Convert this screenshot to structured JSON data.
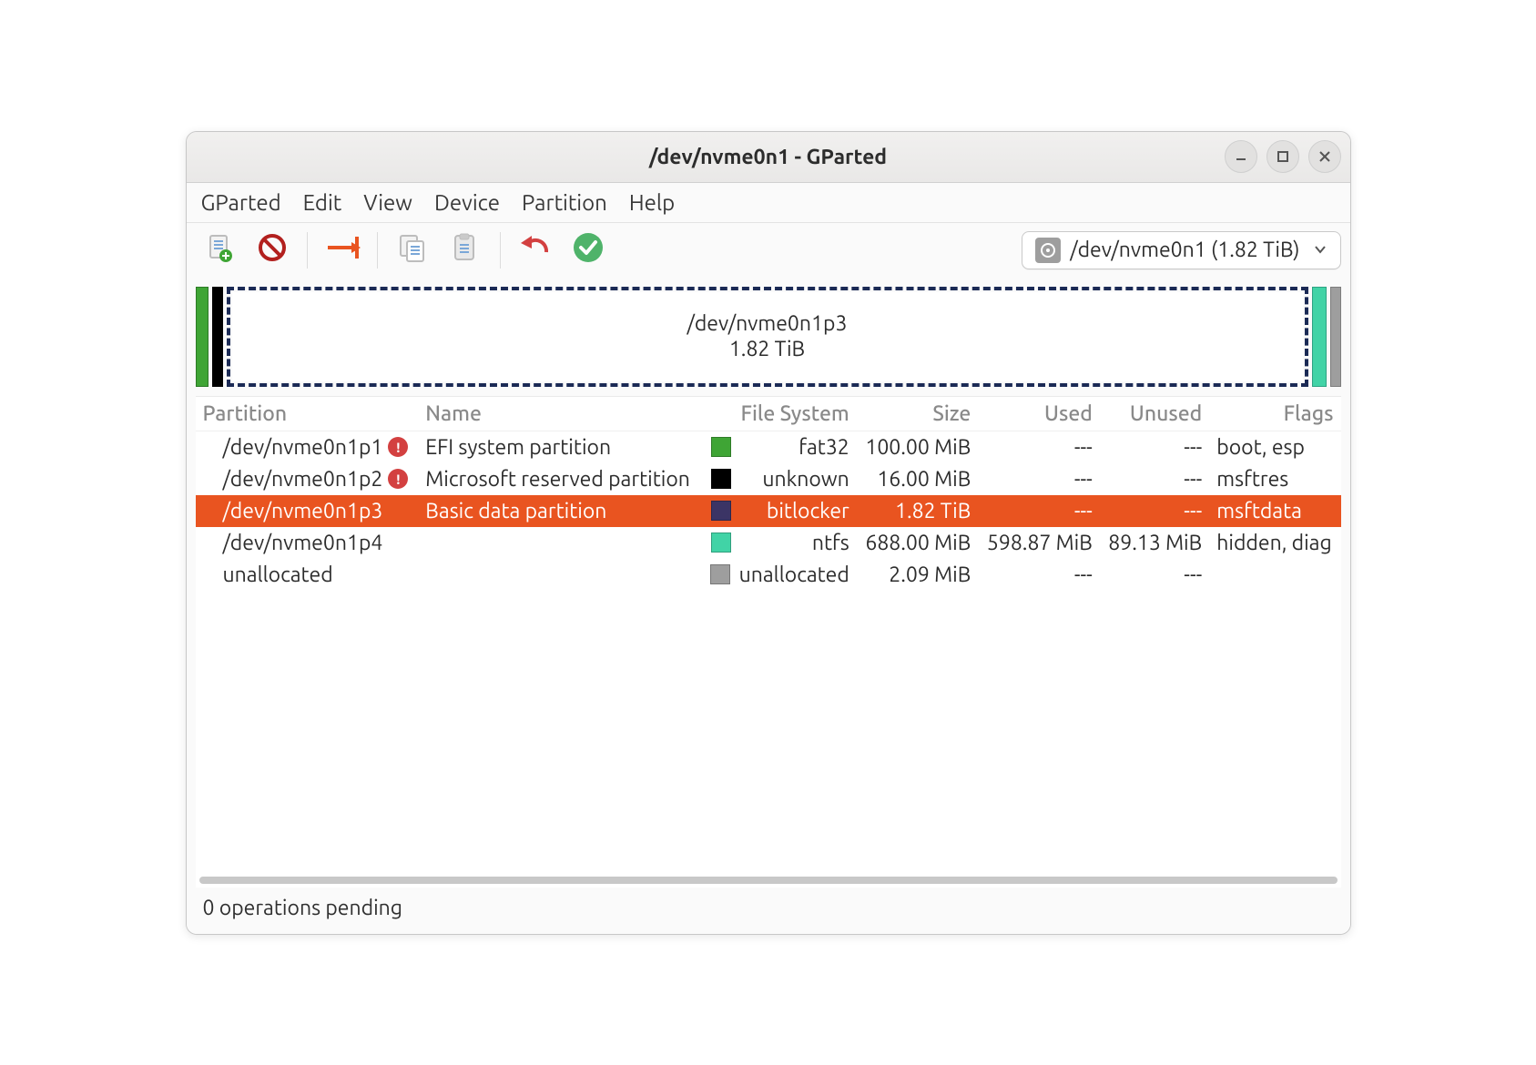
{
  "window": {
    "title": "/dev/nvme0n1 - GParted"
  },
  "menubar": [
    "GParted",
    "Edit",
    "View",
    "Device",
    "Partition",
    "Help"
  ],
  "toolbar": {
    "buttons": [
      "new",
      "delete",
      "resize",
      "copy",
      "paste",
      "undo",
      "apply"
    ]
  },
  "device_selector": {
    "label": "/dev/nvme0n1 (1.82 TiB)"
  },
  "map": {
    "selected": {
      "line1": "/dev/nvme0n1p3",
      "line2": "1.82 TiB"
    }
  },
  "columns": {
    "partition": "Partition",
    "name": "Name",
    "fs": "File System",
    "size": "Size",
    "used": "Used",
    "unused": "Unused",
    "flags": "Flags"
  },
  "fs_colors": {
    "fat32": "#3fa535",
    "unknown": "#000000",
    "bitlocker": "#3b3465",
    "ntfs": "#41d3a6",
    "unallocated": "#9e9e9e"
  },
  "rows": [
    {
      "partition": "/dev/nvme0n1p1",
      "warn": true,
      "name": "EFI system partition",
      "fs": "fat32",
      "size": "100.00 MiB",
      "used": "---",
      "unused": "---",
      "flags": "boot, esp",
      "selected": false
    },
    {
      "partition": "/dev/nvme0n1p2",
      "warn": true,
      "name": "Microsoft reserved partition",
      "fs": "unknown",
      "size": "16.00 MiB",
      "used": "---",
      "unused": "---",
      "flags": "msftres",
      "selected": false
    },
    {
      "partition": "/dev/nvme0n1p3",
      "warn": false,
      "name": "Basic data partition",
      "fs": "bitlocker",
      "size": "1.82 TiB",
      "used": "---",
      "unused": "---",
      "flags": "msftdata",
      "selected": true
    },
    {
      "partition": "/dev/nvme0n1p4",
      "warn": false,
      "name": "",
      "fs": "ntfs",
      "size": "688.00 MiB",
      "used": "598.87 MiB",
      "unused": "89.13 MiB",
      "flags": "hidden, diag",
      "selected": false
    },
    {
      "partition": "unallocated",
      "warn": false,
      "name": "",
      "fs": "unallocated",
      "size": "2.09 MiB",
      "used": "---",
      "unused": "---",
      "flags": "",
      "selected": false
    }
  ],
  "statusbar": {
    "text": "0 operations pending"
  }
}
